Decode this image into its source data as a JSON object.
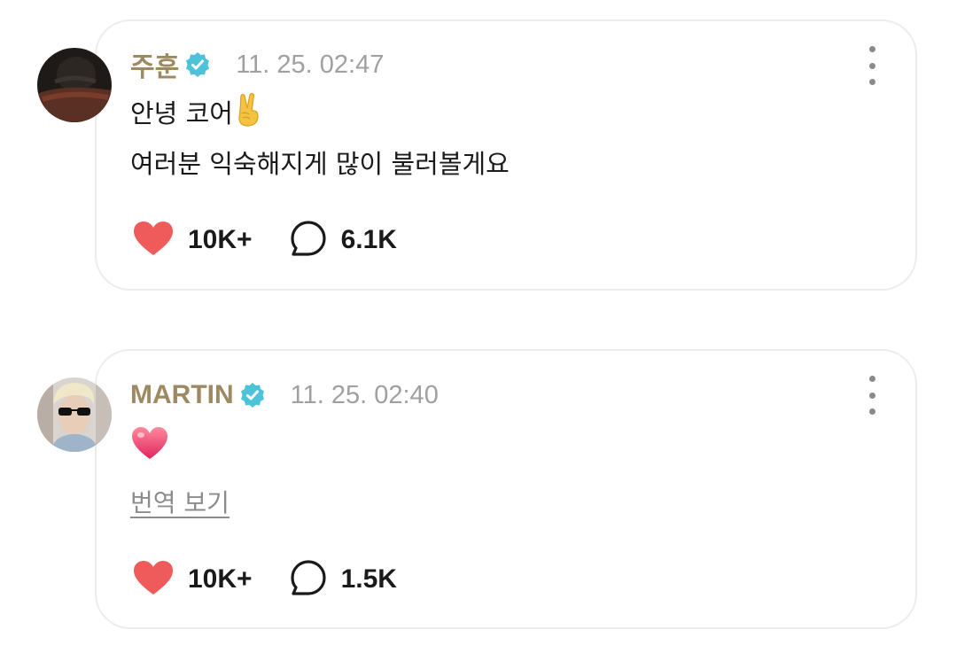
{
  "posts": [
    {
      "author": "주훈",
      "timestamp": "11. 25. 02:47",
      "text_lines": [
        "안녕 코어",
        "여러분 익숙해지게 많이 불러볼게요"
      ],
      "emoji": "victory-hand",
      "likes": "10K+",
      "comments": "6.1K"
    },
    {
      "author": "MARTIN",
      "timestamp": "11. 25. 02:40",
      "emoji": "heart",
      "translate_label": "번역 보기",
      "likes": "10K+",
      "comments": "1.5K"
    }
  ],
  "colors": {
    "author": "#9e8a62",
    "verified_badge": "#4cc3d9",
    "like_heart": "#ef5b5b",
    "timestamp": "#a0a0a0"
  },
  "icons": {
    "verified": "verified-badge-icon",
    "more": "more-vertical-icon",
    "like": "heart-icon",
    "comment": "comment-bubble-icon"
  }
}
